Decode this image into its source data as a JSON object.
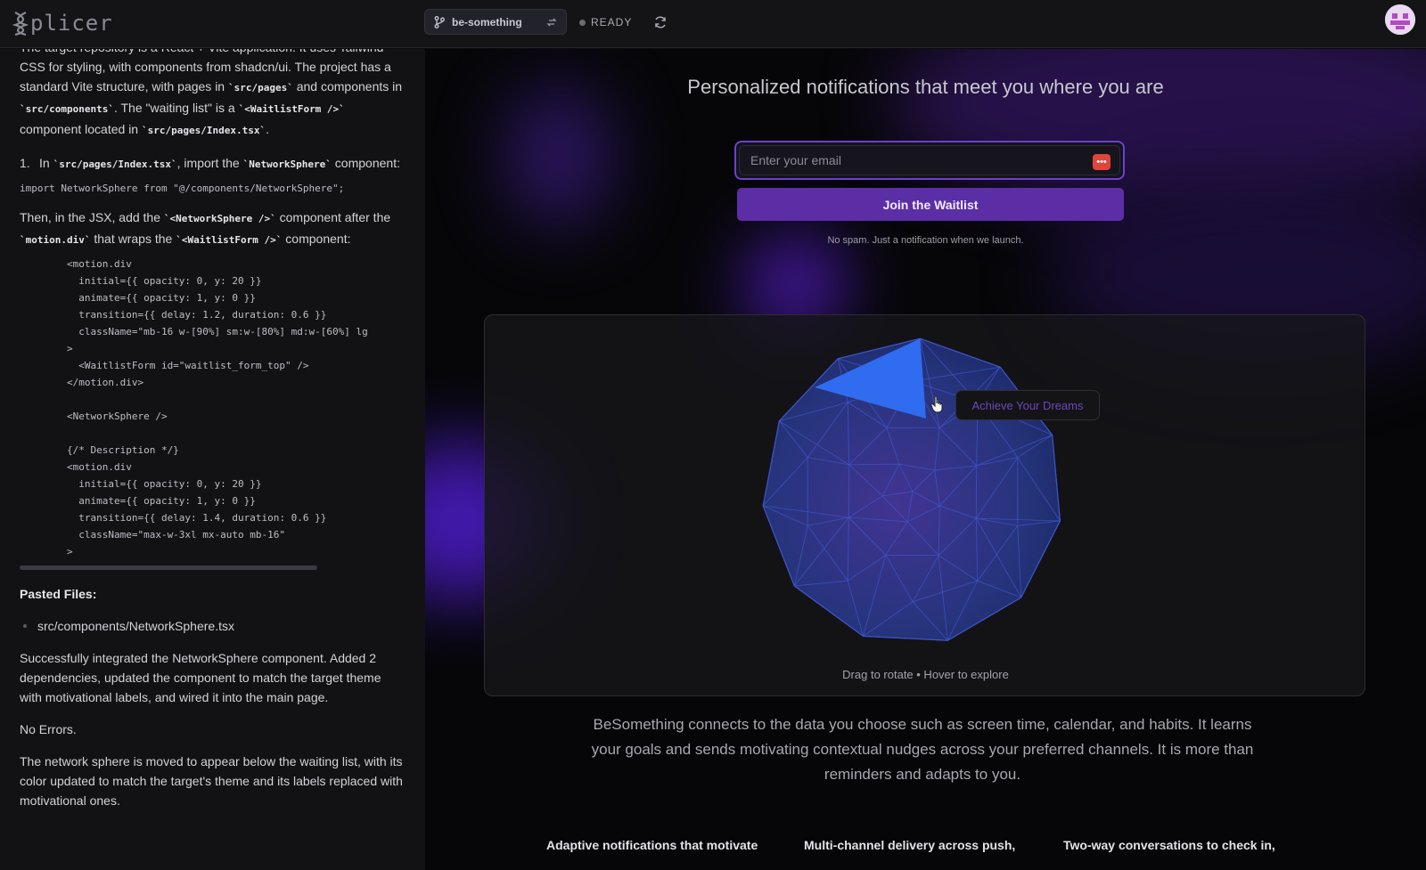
{
  "app": {
    "logo_text": "plicer",
    "branch": "be-something",
    "status": "READY",
    "icons": {
      "logo": "dna-icon",
      "branch": "git-branch-icon",
      "swap": "swap-icon",
      "refresh": "refresh-icon",
      "avatar": "user-avatar"
    }
  },
  "chat": {
    "intro_parts": [
      "The target repository is a React + Vite application. It uses Tailwind CSS for styling, with components from shadcn/ui. The project has a standard Vite structure, with pages in ",
      "`src/pages`",
      " and components in ",
      "`src/components`",
      ". The \"waiting list\" is a ",
      "`<WaitlistForm />`",
      " component located in ",
      "`src/pages/Index.tsx`",
      "."
    ],
    "step_number": "1.",
    "step_parts": [
      "In ",
      "`src/pages/Index.tsx`",
      ", import the ",
      "`NetworkSphere`",
      " component:"
    ],
    "import_line": "import NetworkSphere from \"@/components/NetworkSphere\";",
    "then_parts": [
      "Then, in the JSX, add the ",
      "`<NetworkSphere />`",
      " component after the ",
      "`motion.div`",
      " that wraps the ",
      "`<WaitlistForm />`",
      " component:"
    ],
    "code_lines": [
      "        <motion.div",
      "          initial={{ opacity: 0, y: 20 }}",
      "          animate={{ opacity: 1, y: 0 }}",
      "          transition={{ delay: 1.2, duration: 0.6 }}",
      "          className=\"mb-16 w-[90%] sm:w-[80%] md:w-[60%] lg",
      "        >",
      "          <WaitlistForm id=\"waitlist_form_top\" />",
      "        </motion.div>",
      "",
      "        <NetworkSphere />",
      "",
      "        {/* Description */}",
      "        <motion.div",
      "          initial={{ opacity: 0, y: 20 }}",
      "          animate={{ opacity: 1, y: 0 }}",
      "          transition={{ delay: 1.4, duration: 0.6 }}",
      "          className=\"max-w-3xl mx-auto mb-16\"",
      "        >"
    ],
    "pasted_title": "Pasted Files:",
    "pasted_file": "src/components/NetworkSphere.tsx",
    "success_msg": "Successfully integrated the NetworkSphere component. Added 2 dependencies, updated the component to match the target theme with motivational labels, and wired it into the main page.",
    "no_errors": "No Errors.",
    "final_msg": "The network sphere is moved to appear below the waiting list, with its color updated to match the target's theme and its labels replaced with motivational ones."
  },
  "preview": {
    "hero_title": "Personalized notifications that meet you where you are",
    "email_placeholder": "Enter your email",
    "password_manager_icon": "password-manager-icon",
    "join_button": "Join the Waitlist",
    "no_spam": "No spam. Just a notification when we launch.",
    "tooltip": "Achieve Your Dreams",
    "sphere_caption": "Drag to rotate • Hover to explore",
    "description": "BeSomething connects to the data you choose such as screen time, calendar, and habits. It learns your goals and sends motivating contextual nudges across your preferred channels. It is more than reminders and adapts to you.",
    "features": [
      "Adaptive notifications that motivate",
      "Multi-channel delivery across push,",
      "Two-way conversations to check in,"
    ],
    "colors": {
      "accent": "#5b2ea6",
      "sphere": "#3f55c9",
      "sphere_highlight": "#2f6cf0"
    }
  }
}
